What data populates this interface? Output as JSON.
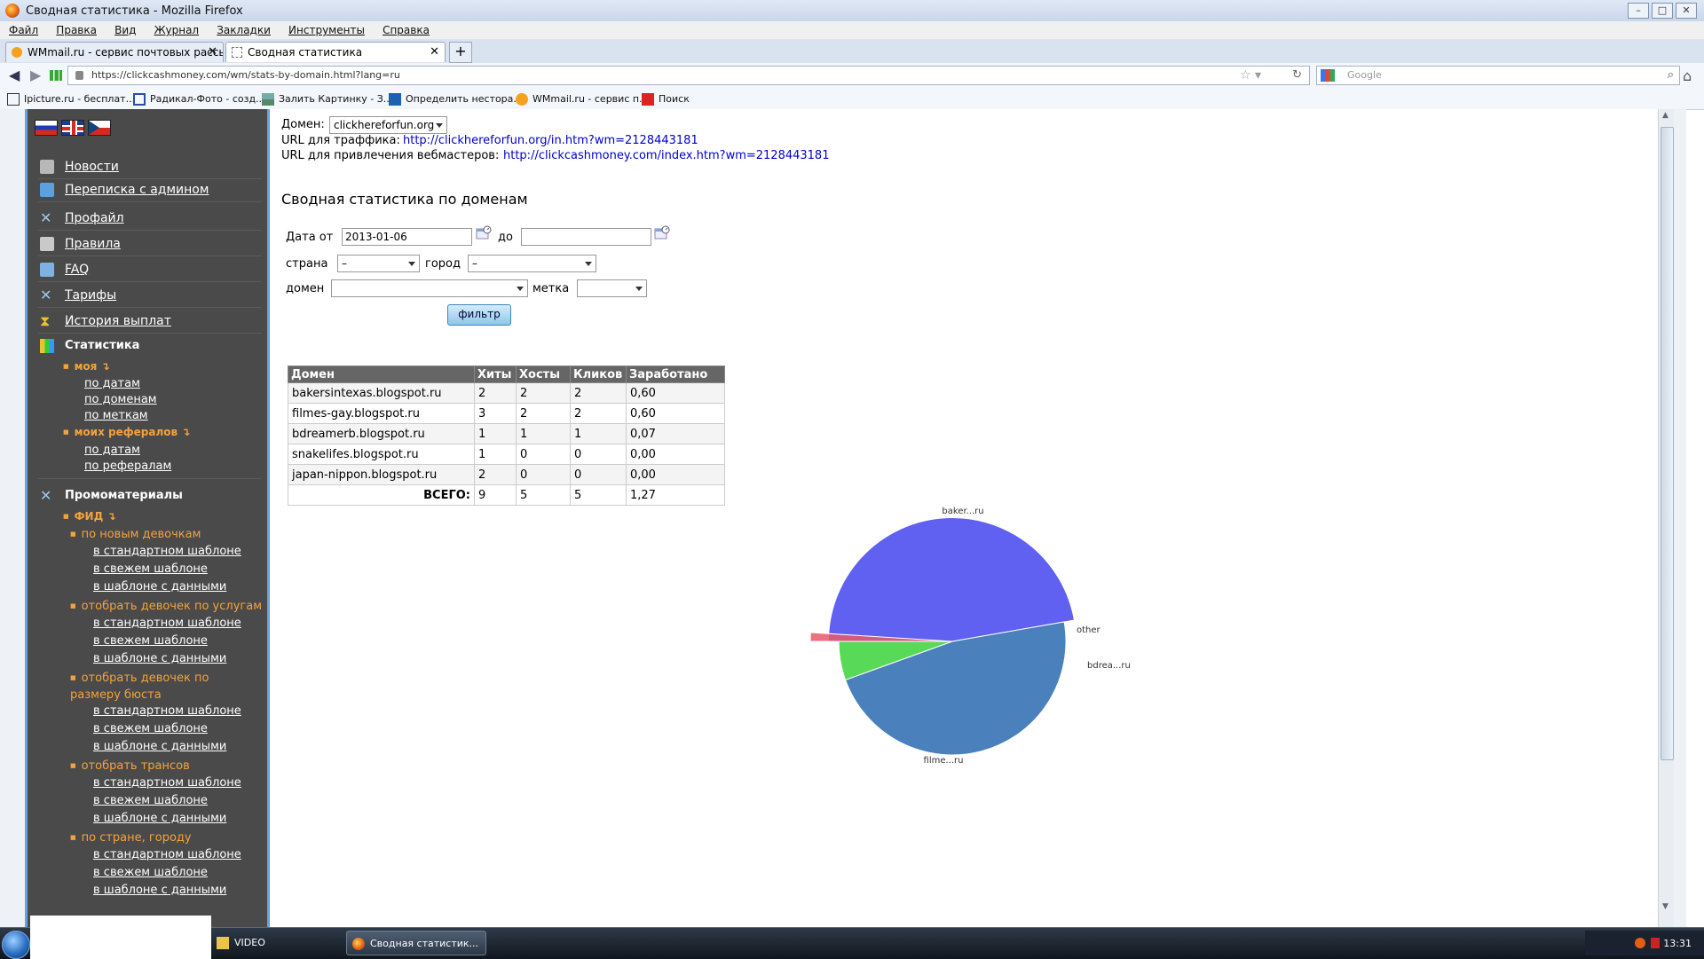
{
  "window": {
    "title": "Сводная статистика - Mozilla Firefox"
  },
  "menubar": [
    "Файл",
    "Правка",
    "Вид",
    "Журнал",
    "Закладки",
    "Инструменты",
    "Справка"
  ],
  "tabs": [
    {
      "label": "WMmail.ru - сервис почтовых рассылок..."
    },
    {
      "label": "Сводная статистика"
    }
  ],
  "navbar": {
    "url": "https://clickcashmoney.com/wm/stats-by-domain.html?lang=ru",
    "search_placeholder": "Google"
  },
  "bookmarks": [
    "Ipicture.ru - бесплат...",
    "Радикал-Фото - созд...",
    "Залить Картинку - З...",
    "Определить нестора...",
    "WMmail.ru - сервис п...",
    "Поиск"
  ],
  "sidebar": {
    "items": [
      {
        "label": "Новости",
        "color": "#b8b8b8"
      },
      {
        "label": "Переписка с админом",
        "color": "#5da0e0"
      },
      {
        "label": "Профайл",
        "color": "#7fb2e0"
      },
      {
        "label": "Правила",
        "color": "#c9c9c9"
      },
      {
        "label": "FAQ",
        "color": "#7fb2e0"
      },
      {
        "label": "Тарифы",
        "color": "#7fb2e0"
      },
      {
        "label": "История выплат",
        "color": "#e8c230"
      }
    ],
    "stats": {
      "label": "Статистика",
      "mine": "моя",
      "mine_links": [
        "по датам",
        "по доменам",
        "по меткам"
      ],
      "referrals": "моих рефералов",
      "referral_links": [
        "по датам",
        "по рефералам"
      ]
    },
    "promo": {
      "label": "Промоматериалы",
      "feed": "ФИД",
      "categories": [
        {
          "label": "по новым девочкам",
          "links": [
            "в стандартном шаблоне",
            "в свежем шаблоне",
            "в шаблоне с данными"
          ]
        },
        {
          "label": "отобрать девочек по услугам",
          "links": [
            "в стандартном шаблоне",
            "в свежем шаблоне",
            "в шаблоне с данными"
          ]
        },
        {
          "label": "отобрать девочек по размеру бюста",
          "links": [
            "в стандартном шаблоне",
            "в свежем шаблоне",
            "в шаблоне с данными"
          ]
        },
        {
          "label": "отобрать трансов",
          "links": [
            "в стандартном шаблоне",
            "в свежем шаблоне",
            "в шаблоне с данными"
          ]
        },
        {
          "label": "по стране, городу",
          "links": [
            "в стандартном шаблоне",
            "в свежем шаблоне",
            "в шаблоне с данными"
          ]
        }
      ]
    }
  },
  "main": {
    "domain_label": "Домен:",
    "domain_value": "clickhereforfun.org",
    "traffic_url_label": "URL для траффика:",
    "traffic_url": "http://clickhereforfun.org/in.htm?wm=2128443181",
    "webmaster_url_label": "URL для привлечения вебмастеров:",
    "webmaster_url": "http://clickcashmoney.com/index.htm?wm=2128443181",
    "heading": "Сводная статистика по доменам",
    "filter": {
      "date_from_label": "Дата от",
      "date_from": "2013-01-06",
      "date_to_label": "до",
      "date_to": "",
      "country_label": "страна",
      "country_value": "–",
      "city_label": "город",
      "city_value": "–",
      "domain_label": "домен",
      "domain_value": "",
      "tag_label": "метка",
      "tag_value": "",
      "button": "фильтр"
    },
    "table": {
      "headers": [
        "Домен",
        "Хиты",
        "Хосты",
        "Кликов",
        "Заработано"
      ],
      "rows": [
        [
          "bakersintexas.blogspot.ru",
          "2",
          "2",
          "2",
          "0,60"
        ],
        [
          "filmes-gay.blogspot.ru",
          "3",
          "2",
          "2",
          "0,60"
        ],
        [
          "bdreamerb.blogspot.ru",
          "1",
          "1",
          "1",
          "0,07"
        ],
        [
          "snakelifes.blogspot.ru",
          "1",
          "0",
          "0",
          "0,00"
        ],
        [
          "japan-nippon.blogspot.ru",
          "2",
          "0",
          "0",
          "0,00"
        ]
      ],
      "total_label": "ВСЕГО:",
      "totals": [
        "9",
        "5",
        "5",
        "1,27"
      ]
    }
  },
  "chart_data": {
    "type": "pie",
    "slices": [
      {
        "label": "baker...ru",
        "value": 0.6,
        "color": "#4444ee"
      },
      {
        "label": "filme...ru",
        "value": 0.6,
        "color": "#2a6ab0"
      },
      {
        "label": "bdrea...ru",
        "value": 0.07,
        "color": "#3bd33b"
      },
      {
        "label": "other",
        "value": 0.0,
        "color": "#e85a6a"
      }
    ]
  },
  "taskbar": {
    "items": [
      "VIDEO",
      "Сводная статистик..."
    ],
    "clock": "13:31"
  }
}
